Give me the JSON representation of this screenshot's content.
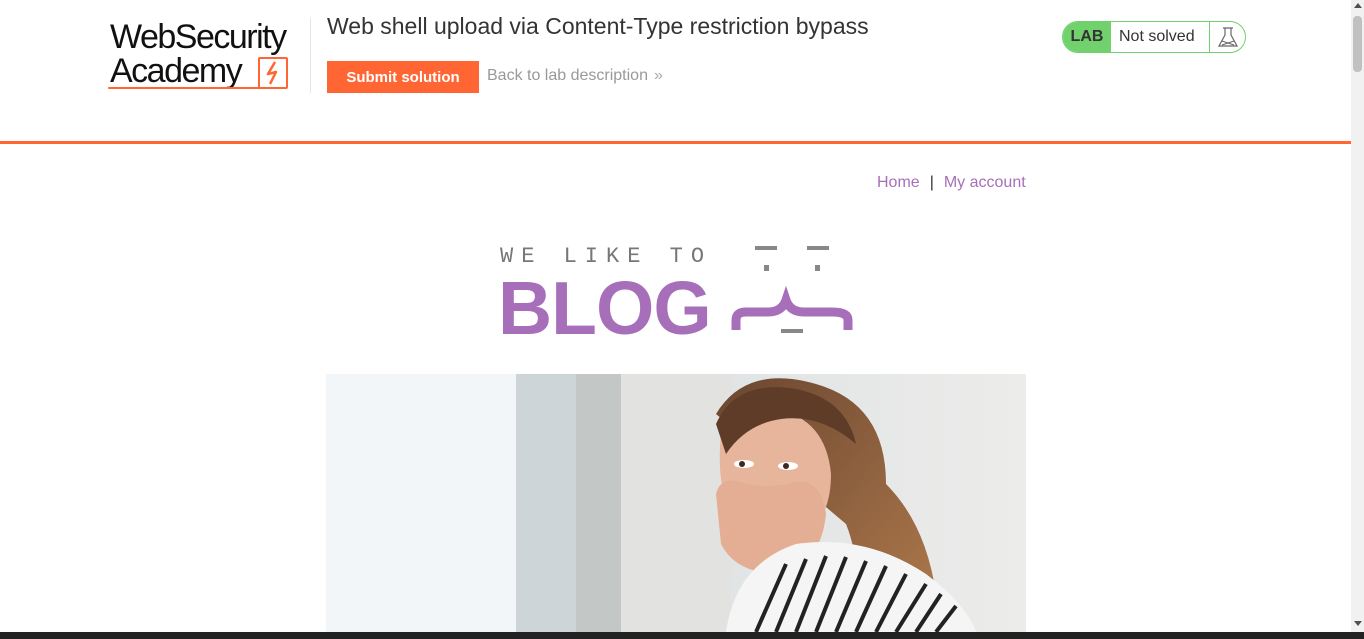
{
  "academy": {
    "logo_line1": "WebSecurity",
    "logo_line2": "Academy",
    "lab_title": "Web shell upload via Content-Type restriction bypass",
    "submit_label": "Submit solution",
    "back_label": "Back to lab description",
    "back_chevron": "»",
    "lab_badge": "LAB",
    "status": "Not solved",
    "status_icon": "flask-icon",
    "colors": {
      "accent": "#ff6633",
      "lab_green": "#70d16d",
      "blog_purple": "#a76fb9"
    }
  },
  "blog": {
    "nav": {
      "home": "Home",
      "separator": "|",
      "account": "My account"
    },
    "logo": {
      "tagline": "WE LIKE TO",
      "word": "BLOG"
    },
    "hero_alt": "woman covering mouth with hands"
  }
}
